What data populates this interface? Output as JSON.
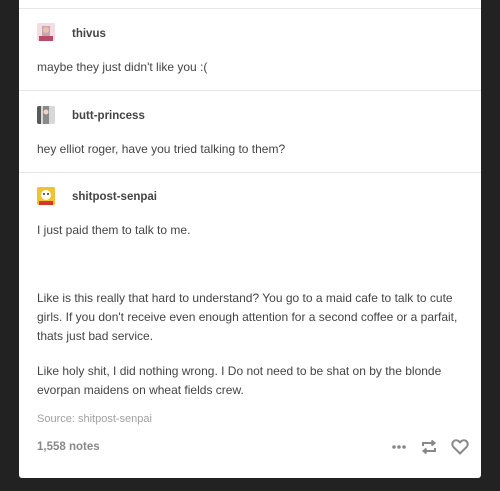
{
  "posts": [
    {
      "username": "thivus",
      "text": "maybe they just didn't like you :("
    },
    {
      "username": "butt-princess",
      "text": "hey elliot roger, have you tried talking to them?"
    },
    {
      "username": "shitpost-senpai",
      "paragraphs": [
        "I just paid them to talk to me.",
        "Like is this really that hard to understand? You go to a maid cafe to talk to cute girls. If you don't receive even enough attention for a second coffee or a parfait, thats just bad service.",
        "Like holy shit, I did nothing wrong. I Do not need to be shat on by the blonde evorpan maidens on wheat fields crew."
      ]
    }
  ],
  "source": "Source: shitpost-senpai",
  "notes": "1,558 notes",
  "icons": {
    "more": "more-icon",
    "reblog": "reblog-icon",
    "like": "heart-icon"
  }
}
